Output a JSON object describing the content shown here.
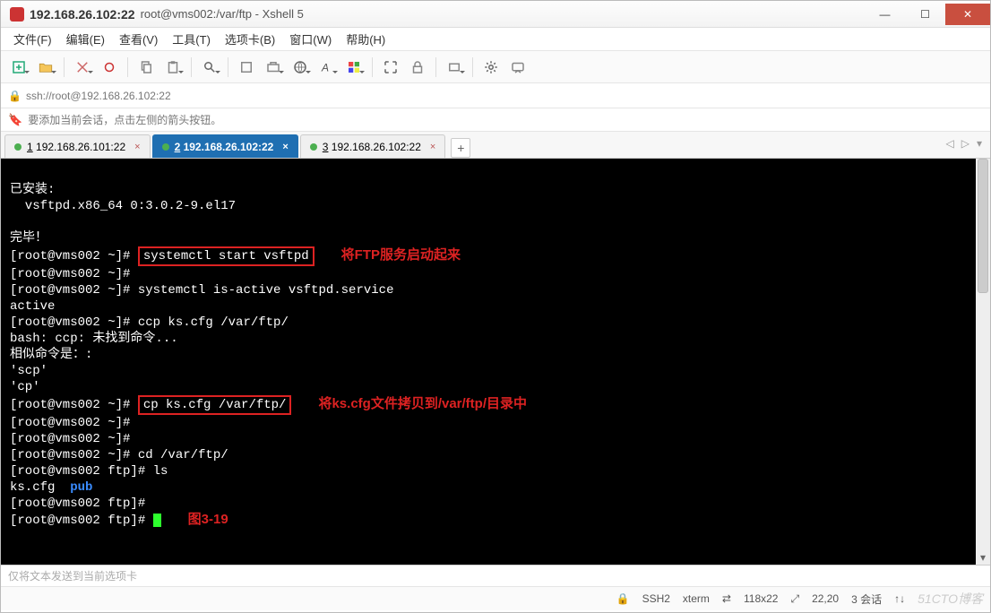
{
  "window": {
    "title_bold": "192.168.26.102:22",
    "title_rest": "root@vms002:/var/ftp - Xshell 5"
  },
  "menu": {
    "file": "文件(F)",
    "edit": "编辑(E)",
    "view": "查看(V)",
    "tools": "工具(T)",
    "tabs": "选项卡(B)",
    "window": "窗口(W)",
    "help": "帮助(H)"
  },
  "address": {
    "url": "ssh://root@192.168.26.102:22"
  },
  "hint": {
    "text": "要添加当前会话，点击左侧的箭头按钮。"
  },
  "tabs": {
    "t1": "1 192.168.26.101:22",
    "t2": "2 192.168.26.102:22",
    "t3": "3 192.168.26.102:22",
    "add": "+"
  },
  "terminal": {
    "l1": "已安装:",
    "l2": "  vsftpd.x86_64 0:3.0.2-9.el17",
    "l3": "",
    "l4": "完毕！",
    "l5p": "[root@vms002 ~]# ",
    "l5cmd": "systemctl start vsftpd",
    "ann1": "将FTP服务启动起来",
    "l6": "[root@vms002 ~]#",
    "l7": "[root@vms002 ~]# systemctl is-active vsftpd.service",
    "l8": "active",
    "l9": "[root@vms002 ~]# ccp ks.cfg /var/ftp/",
    "l10": "bash: ccp: 未找到命令...",
    "l11": "相似命令是：:",
    "l12": "'scp'",
    "l13": "'cp'",
    "l14p": "[root@vms002 ~]# ",
    "l14cmd": "cp ks.cfg /var/ftp/",
    "ann2": "将ks.cfg文件拷贝到/var/ftp/目录中",
    "l15": "[root@vms002 ~]#",
    "l16": "[root@vms002 ~]#",
    "l17": "[root@vms002 ~]# cd /var/ftp/",
    "l18": "[root@vms002 ftp]# ls",
    "l19a": "ks.cfg  ",
    "l19b": "pub",
    "l20": "[root@vms002 ftp]#",
    "l21": "[root@vms002 ftp]# ",
    "fig": "图3-19"
  },
  "sendbar": {
    "placeholder": "仅将文本发送到当前选项卡"
  },
  "status": {
    "proto": "SSH2",
    "termtype": "xterm",
    "size_icon": "⇄",
    "size": "118x22",
    "pos_icon": "⤢",
    "pos": "22,20",
    "sessions": "3 会话",
    "net_icon": "↑↓",
    "watermark": "51CTO博客"
  },
  "icons": {
    "lock_closed": "🔒"
  }
}
